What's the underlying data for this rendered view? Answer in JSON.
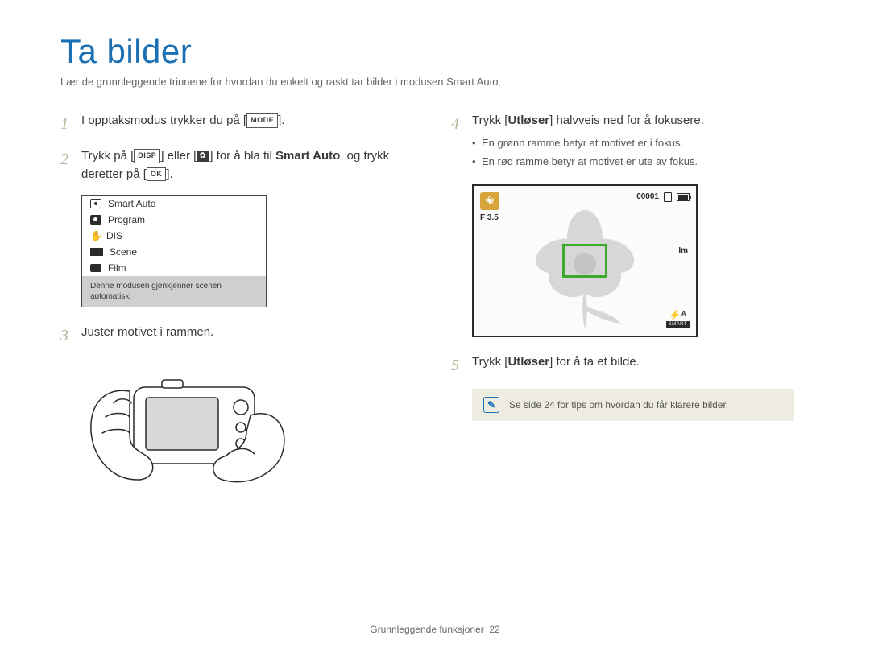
{
  "title": "Ta bilder",
  "subtitle": "Lær de grunnleggende trinnene for hvordan du enkelt og raskt tar bilder i modusen Smart Auto.",
  "steps": {
    "s1": {
      "num": "1",
      "text_before": "I opptaksmodus trykker du på [",
      "label": "MODE",
      "text_after": "]."
    },
    "s2": {
      "num": "2",
      "t1": "Trykk på [",
      "label1": "DISP",
      "t2": "] eller [",
      "t3": "] for å bla til ",
      "bold": "Smart Auto",
      "t4": ", og trykk deretter på [",
      "label2": "OK",
      "t5": "]."
    },
    "s3": {
      "num": "3",
      "text": "Juster motivet i rammen."
    },
    "s4": {
      "num": "4",
      "t1": "Trykk [",
      "bold": "Utløser",
      "t2": "] halvveis ned for å fokusere.",
      "bullets": [
        "En grønn ramme betyr at motivet er i fokus.",
        "En rød ramme betyr at motivet er ute av fokus."
      ]
    },
    "s5": {
      "num": "5",
      "t1": "Trykk [",
      "bold": "Utløser",
      "t2": "] for å ta et bilde."
    }
  },
  "mode_menu": {
    "items": [
      "Smart Auto",
      "Program",
      "DIS",
      "Scene",
      "Film"
    ],
    "description": "Denne modusen gjenkjenner scenen automatisk."
  },
  "lcd": {
    "counter": "00001",
    "aperture": "F 3.5",
    "right_mid": "Im",
    "flash": "⚡ᴬ",
    "smart": "SMART"
  },
  "tip": "Se side 24 for tips om hvordan du får klarere bilder.",
  "footer": {
    "label": "Grunnleggende funksjoner",
    "page": "22"
  }
}
